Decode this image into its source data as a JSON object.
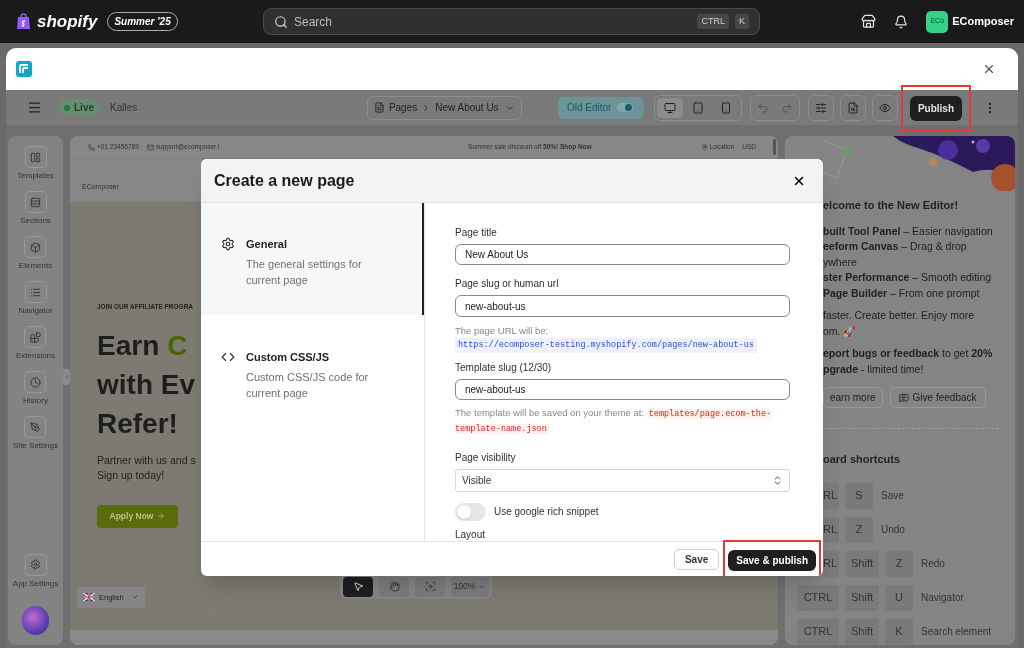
{
  "top_bar": {
    "brand": "shopify",
    "badge": "Summer '25",
    "search": {
      "placeholder": "Search",
      "keys": [
        "CTRL",
        "K"
      ]
    },
    "account": {
      "avatar": "ECo",
      "name": "EComposer"
    }
  },
  "toolbar": {
    "status": "Live",
    "store": "Kalles",
    "breadcrumb": [
      "Pages",
      "New About Us"
    ],
    "old_editor": {
      "label": "Old Editor",
      "on": true
    },
    "devices": [
      {
        "kind": "desktop",
        "selected": true
      },
      {
        "kind": "tablet",
        "selected": false
      },
      {
        "kind": "mobile",
        "selected": false
      }
    ],
    "publish": "Publish"
  },
  "sidebar": {
    "items": [
      {
        "kind": "templates",
        "label": "Templates"
      },
      {
        "kind": "sections",
        "label": "Sections"
      },
      {
        "kind": "elements",
        "label": "Elements"
      },
      {
        "kind": "navigator",
        "label": "Navigator"
      },
      {
        "kind": "extensions",
        "label": "Extensions"
      },
      {
        "kind": "history",
        "label": "History"
      },
      {
        "kind": "site",
        "label": "Site Settings"
      }
    ],
    "footer": "App Settings"
  },
  "canvas": {
    "phone": "+01 23456789",
    "email": "support@ecomposer.i",
    "promo": "Summer sale discount off **50%! Shop Now**",
    "location": "Location",
    "currency": "USD",
    "logo": "EComposer",
    "eyebrow": "JOIN OUR AFFILIATE PROGRA",
    "headline": [
      [
        {
          "text": "Earn",
          "accent": false
        },
        {
          "text": "C",
          "accent": true
        }
      ],
      [
        {
          "text": "with Ev",
          "accent": false
        }
      ],
      [
        {
          "text": "Refer!",
          "accent": false
        }
      ]
    ],
    "body": [
      "Partner with us and s",
      "Sign up today!"
    ],
    "cta": "Apply Now",
    "language": "English",
    "zoom": "100%",
    "tools": [
      {
        "kind": "pointer",
        "selected": true
      },
      {
        "kind": "hand",
        "selected": false
      },
      {
        "kind": "focus",
        "selected": false
      }
    ]
  },
  "modal": {
    "title": "Create a new page",
    "nav": [
      {
        "kind": "general",
        "title": "General",
        "description": "The general settings for current page",
        "selected": true
      },
      {
        "kind": "code",
        "title": "Custom CSS/JS",
        "description": "Custom CSS/JS code for current page",
        "selected": false
      }
    ],
    "page_title": {
      "label": "Page title",
      "value": "New About Us"
    },
    "slug": {
      "label": "Page slug or human url",
      "value": "new-about-us"
    },
    "url_hint": {
      "text": "The page URL will be:",
      "url": "https://ecomposer-testing.myshopify.com/pages/new-about-us"
    },
    "template_slug": {
      "label": "Template slug (12/30)",
      "value": "new-about-us"
    },
    "template_hint": {
      "text": "The template will be saved on your theme at:",
      "path": "templates/page.ecom-the-template-name.json"
    },
    "visibility": {
      "label": "Page visibility",
      "value": "Visible"
    },
    "rich_snippet": {
      "label": "Use google rich snippet",
      "on": false
    },
    "layout_label": "Layout",
    "save": "Save",
    "save_publish": "Save & publish"
  },
  "right_panel": {
    "title": "elcome to the New Editor!",
    "lines": [
      "**built Tool Panel** – Easier navigation",
      "**eeform Canvas** – Drag & drop",
      "ywhere",
      "**ster Performance** – Smooth editing",
      "**Page Builder** – From one prompt"
    ],
    "tagline": [
      "faster. Create better. Enjoy more",
      "om. 🚀"
    ],
    "feedback": [
      "**eport bugs or feedback** to get **20%**",
      "**pgrade** - limited time!"
    ],
    "learn": "earn more",
    "give_feedback": "Give feedback",
    "shortcuts_title": "oard shortcuts",
    "shortcuts": [
      {
        "kind": "cut",
        "keys": [
          "RL",
          "S"
        ],
        "action": "Save"
      },
      {
        "kind": "cut",
        "keys": [
          "RL",
          "Z"
        ],
        "action": "Undo"
      },
      {
        "kind": "cut",
        "keys": [
          "RL",
          "Shift",
          "Z"
        ],
        "action": "Redo"
      },
      {
        "kind": "whole",
        "keys": [
          "CTRL",
          "Shift",
          "U"
        ],
        "action": "Navigator"
      },
      {
        "kind": "whole",
        "keys": [
          "CTRL",
          "Shift",
          "K"
        ],
        "action": "Search element"
      }
    ]
  }
}
